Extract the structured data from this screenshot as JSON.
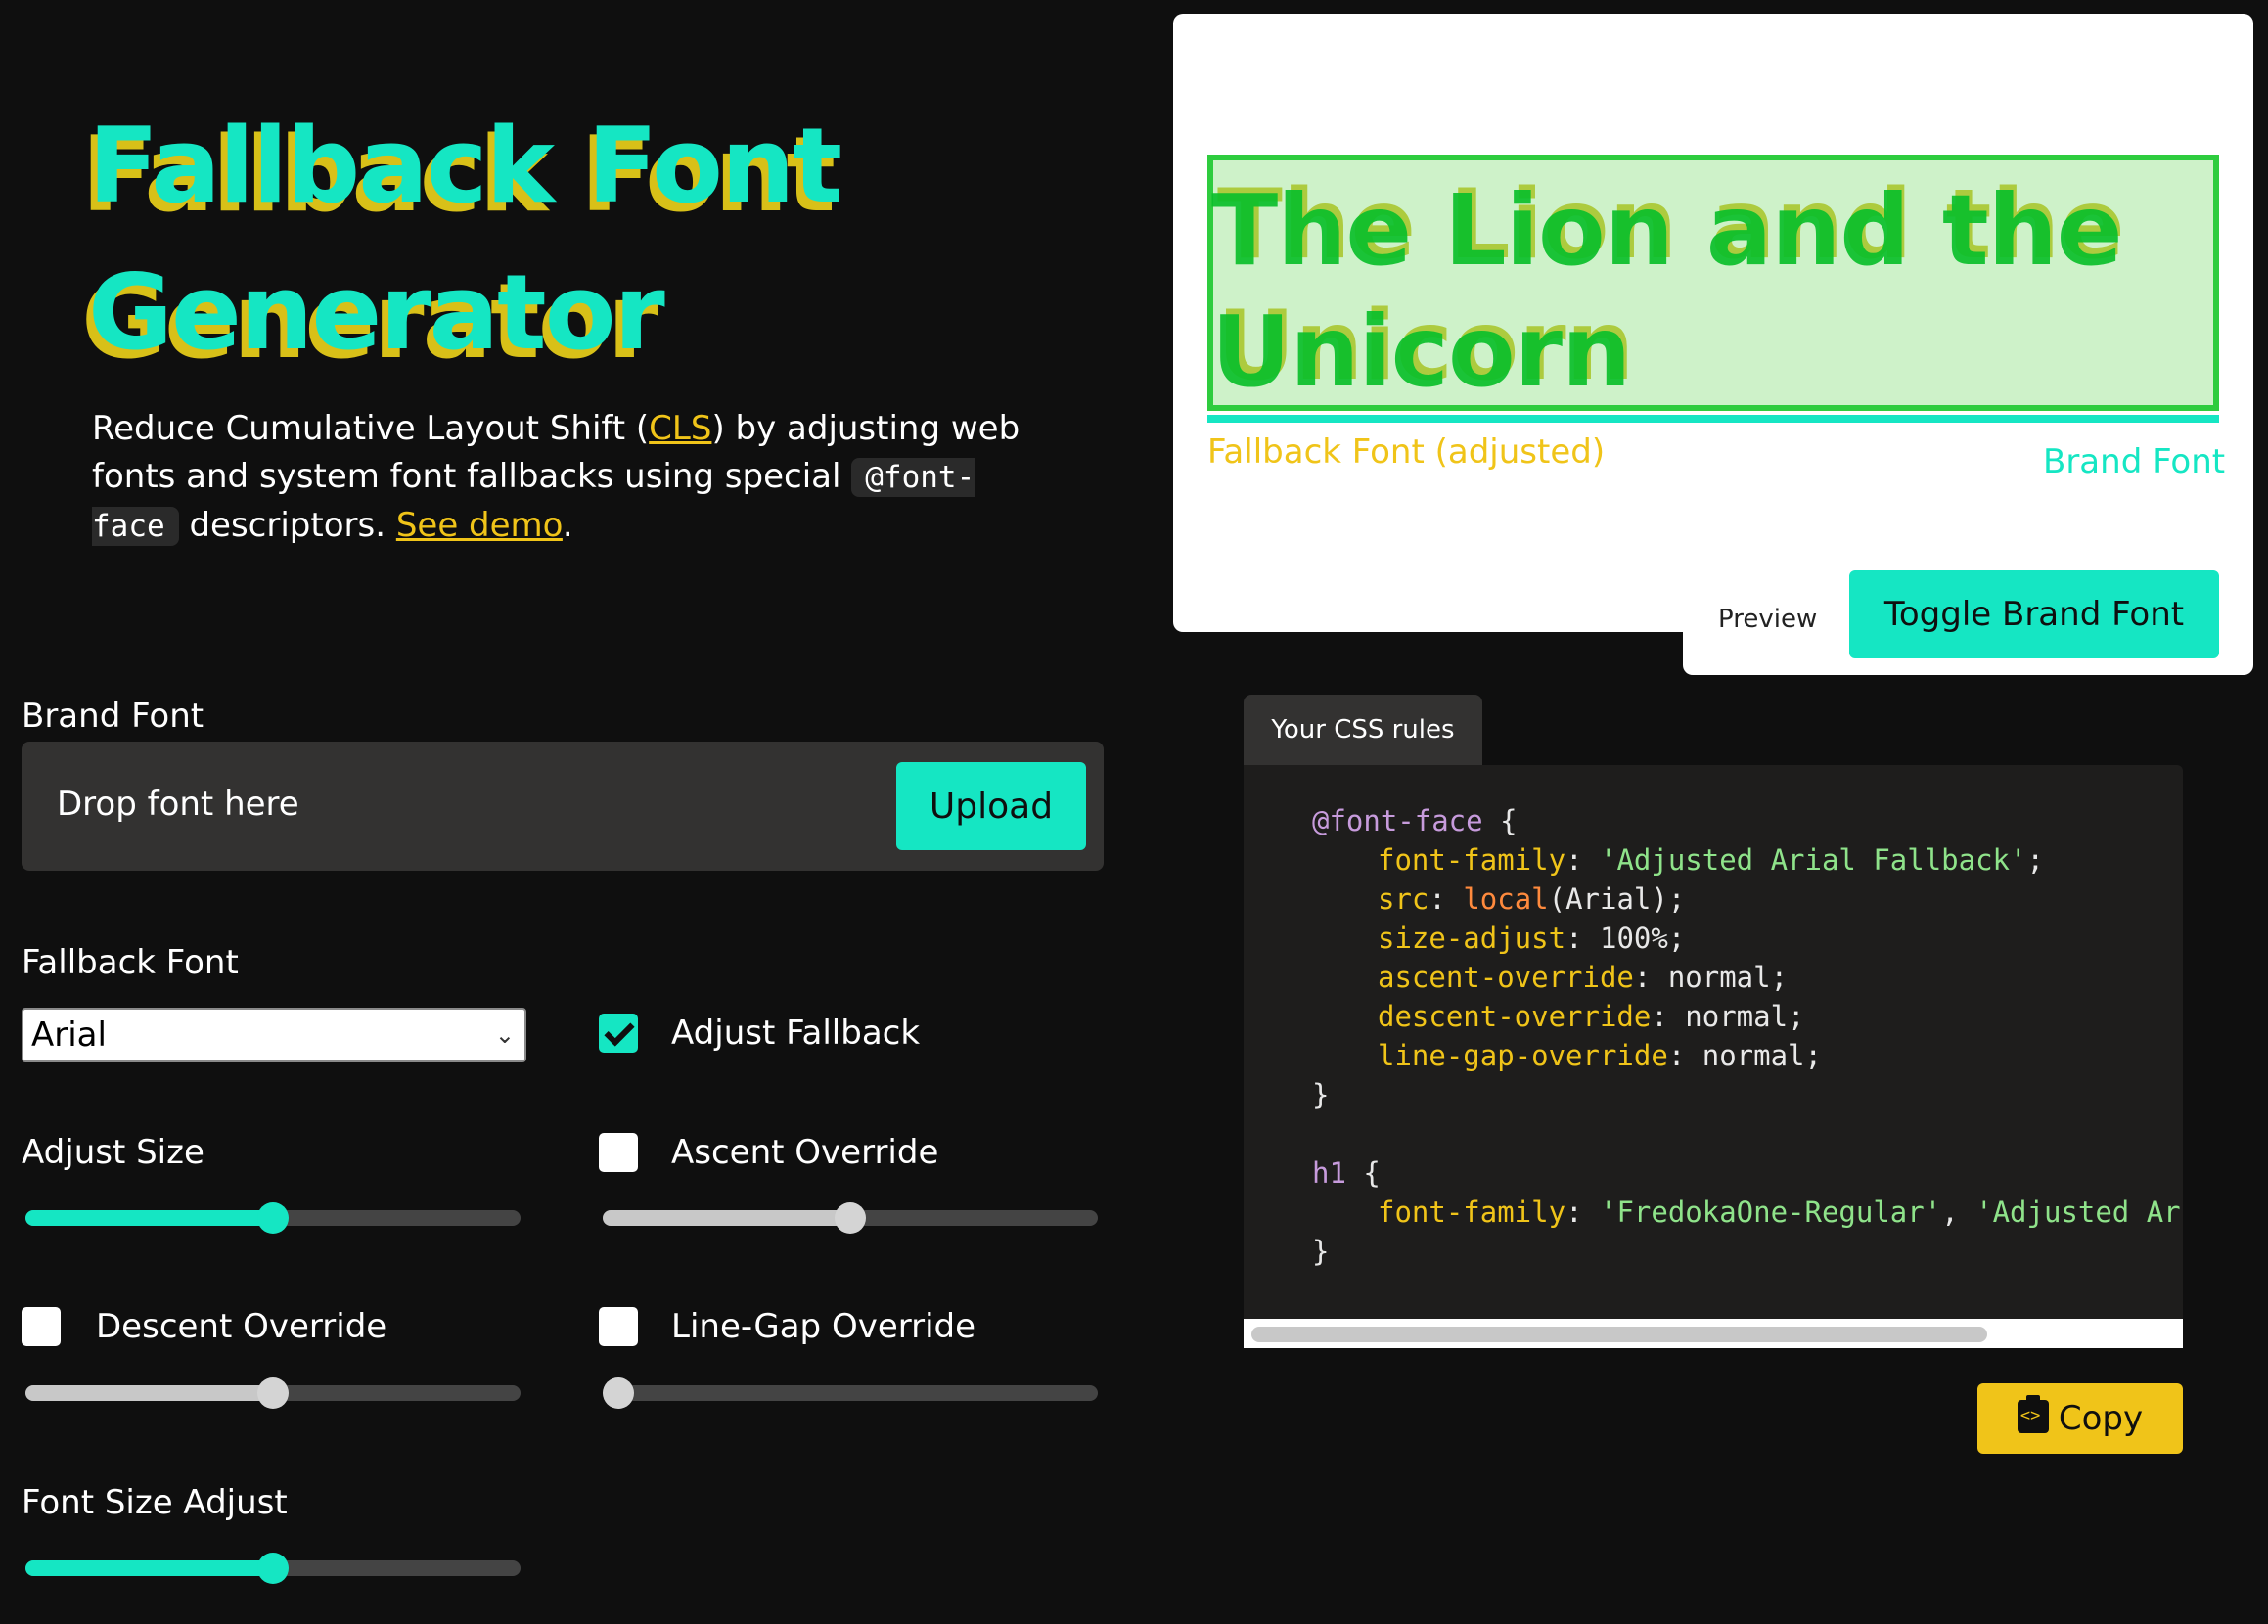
{
  "header": {
    "title_line1": "Fallback Font",
    "title_line2": "Generator"
  },
  "intro": {
    "part1": "Reduce Cumulative Layout Shift (",
    "cls_link": "CLS",
    "part2": ") by adjusting web fonts and system font fallbacks using special ",
    "code": "@font-face",
    "part3": " descriptors. ",
    "demo_link": "See demo",
    "part4": "."
  },
  "brand_font": {
    "label": "Brand Font",
    "drop_text": "Drop font here",
    "upload_label": "Upload"
  },
  "fallback_font": {
    "label": "Fallback Font",
    "selected": "Arial"
  },
  "options": {
    "adjust_fallback": {
      "label": "Adjust Fallback",
      "checked": true
    },
    "adjust_size": {
      "label": "Adjust Size",
      "value": 0.5
    },
    "ascent_override": {
      "label": "Ascent Override",
      "checked": false,
      "value": 0.5
    },
    "descent_override": {
      "label": "Descent Override",
      "checked": false,
      "value": 0.5
    },
    "line_gap_override": {
      "label": "Line-Gap Override",
      "checked": false,
      "value": 0.0
    },
    "font_size_adjust": {
      "label": "Font Size Adjust",
      "value": 0.5
    }
  },
  "preview": {
    "sample_text": "The Lion and the Unicorn",
    "fallback_caption": "Fallback Font (adjusted)",
    "brand_caption": "Brand Font",
    "preview_label": "Preview",
    "toggle_label": "Toggle Brand Font"
  },
  "css_panel": {
    "tab_label": "Your CSS rules",
    "copy_label": "Copy",
    "lines": [
      "@font-face {",
      "font-family: 'Adjusted Arial Fallback';",
      "src: local(Arial);",
      "size-adjust: 100%;",
      "ascent-override: normal;",
      "descent-override: normal;",
      "line-gap-override: normal;",
      "}",
      "h1 {",
      "font-family: 'FredokaOne-Regular', 'Adjusted Arial",
      "}"
    ],
    "tokens": {
      "at_rule": "@font-face",
      "brace_open": " {",
      "brace_close": "}",
      "ff_prop": "font-family",
      "ff_value": "'Adjusted Arial Fallback'",
      "src_prop": "src",
      "src_fn": "local",
      "src_arg": "(Arial);",
      "size_prop": "size-adjust",
      "size_value": " 100%;",
      "ascent_prop": "ascent-override",
      "ascent_value": " normal;",
      "descent_prop": "descent-override",
      "descent_value": " normal;",
      "linegap_prop": "line-gap-override",
      "linegap_value": " normal;",
      "h1_sel": "h1",
      "h1_ff_prop": "font-family",
      "h1_ff_v1": "'FredokaOne-Regular'",
      "h1_ff_sep": ", ",
      "h1_ff_v2": "'Adjusted Arial"
    }
  },
  "colors": {
    "accent": "#15e6c3",
    "highlight": "#f0c419",
    "background": "#0f0f0f"
  }
}
